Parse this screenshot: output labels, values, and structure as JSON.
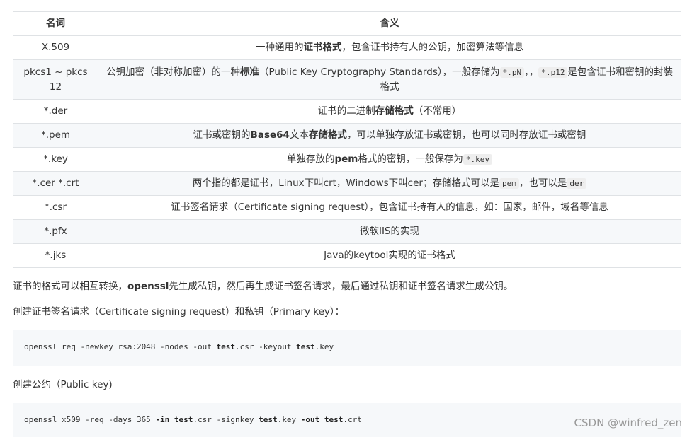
{
  "table": {
    "headers": [
      "名词",
      "含义"
    ],
    "rows": [
      {
        "term": "X.509",
        "tall": false,
        "meaning": [
          {
            "t": "text",
            "v": "一种通用的"
          },
          {
            "t": "bold",
            "v": "证书格式"
          },
          {
            "t": "text",
            "v": "，包含证书持有人的公钥，加密算法等信息"
          }
        ]
      },
      {
        "term": "pkcs1 ~ pkcs 12",
        "tall": true,
        "meaning": [
          {
            "t": "text",
            "v": "公钥加密（非对称加密）的一种"
          },
          {
            "t": "bold",
            "v": "标准"
          },
          {
            "t": "text",
            "v": "（Public Key Cryptography Standards），一般存储为"
          },
          {
            "t": "code",
            "v": "*.pN"
          },
          {
            "t": "text",
            "v": "，，"
          },
          {
            "t": "code",
            "v": "*.p12"
          },
          {
            "t": "text",
            "v": "是包含证书和密钥的封装格式"
          }
        ]
      },
      {
        "term": "*.der",
        "tall": false,
        "meaning": [
          {
            "t": "text",
            "v": "证书的二进制"
          },
          {
            "t": "bold",
            "v": "存储格式"
          },
          {
            "t": "text",
            "v": "（不常用）"
          }
        ]
      },
      {
        "term": "*.pem",
        "tall": false,
        "meaning": [
          {
            "t": "text",
            "v": "证书或密钥的"
          },
          {
            "t": "bold",
            "v": "Base64"
          },
          {
            "t": "text",
            "v": "文本"
          },
          {
            "t": "bold",
            "v": "存储格式"
          },
          {
            "t": "text",
            "v": "，可以单独存放证书或密钥，也可以同时存放证书或密钥"
          }
        ]
      },
      {
        "term": "*.key",
        "tall": false,
        "meaning": [
          {
            "t": "text",
            "v": "单独存放的"
          },
          {
            "t": "bold",
            "v": "pem"
          },
          {
            "t": "text",
            "v": "格式的密钥，一般保存为"
          },
          {
            "t": "code",
            "v": "*.key"
          }
        ]
      },
      {
        "term": "*.cer *.crt",
        "tall": false,
        "meaning": [
          {
            "t": "text",
            "v": "两个指的都是证书，Linux下叫crt，Windows下叫cer；存储格式可以是"
          },
          {
            "t": "code",
            "v": "pem"
          },
          {
            "t": "text",
            "v": "，也可以是"
          },
          {
            "t": "code",
            "v": "der"
          }
        ]
      },
      {
        "term": "*.csr",
        "tall": false,
        "meaning": [
          {
            "t": "text",
            "v": "证书签名请求（Certificate signing request），包含证书持有人的信息，如：国家，邮件，域名等信息"
          }
        ]
      },
      {
        "term": "*.pfx",
        "tall": false,
        "meaning": [
          {
            "t": "text",
            "v": "微软IIS的实现"
          }
        ]
      },
      {
        "term": "*.jks",
        "tall": false,
        "meaning": [
          {
            "t": "text",
            "v": "Java的keytool实现的证书格式"
          }
        ]
      }
    ]
  },
  "para1": [
    {
      "t": "text",
      "v": "证书的格式可以相互转换，"
    },
    {
      "t": "bold",
      "v": "openssl"
    },
    {
      "t": "text",
      "v": "先生成私钥，然后再生成证书签名请求，最后通过私钥和证书签名请求生成公钥。"
    }
  ],
  "para2": "创建证书签名请求（Certificate signing request）和私钥（Primary key）：",
  "code1": [
    {
      "t": "plain",
      "v": "openssl req -newkey rsa:2048 -nodes -out "
    },
    {
      "t": "bold",
      "v": "test"
    },
    {
      "t": "plain",
      "v": ".csr -keyout "
    },
    {
      "t": "bold",
      "v": "test"
    },
    {
      "t": "plain",
      "v": ".key"
    }
  ],
  "para3": "创建公约（Public key)",
  "code2": [
    {
      "t": "plain",
      "v": "openssl x509 -req -days 365 "
    },
    {
      "t": "bold",
      "v": "-in test"
    },
    {
      "t": "plain",
      "v": ".csr -signkey "
    },
    {
      "t": "bold",
      "v": "test"
    },
    {
      "t": "plain",
      "v": ".key "
    },
    {
      "t": "bold",
      "v": "-out test"
    },
    {
      "t": "plain",
      "v": ".crt"
    }
  ],
  "watermark": "CSDN @winfred_zen"
}
